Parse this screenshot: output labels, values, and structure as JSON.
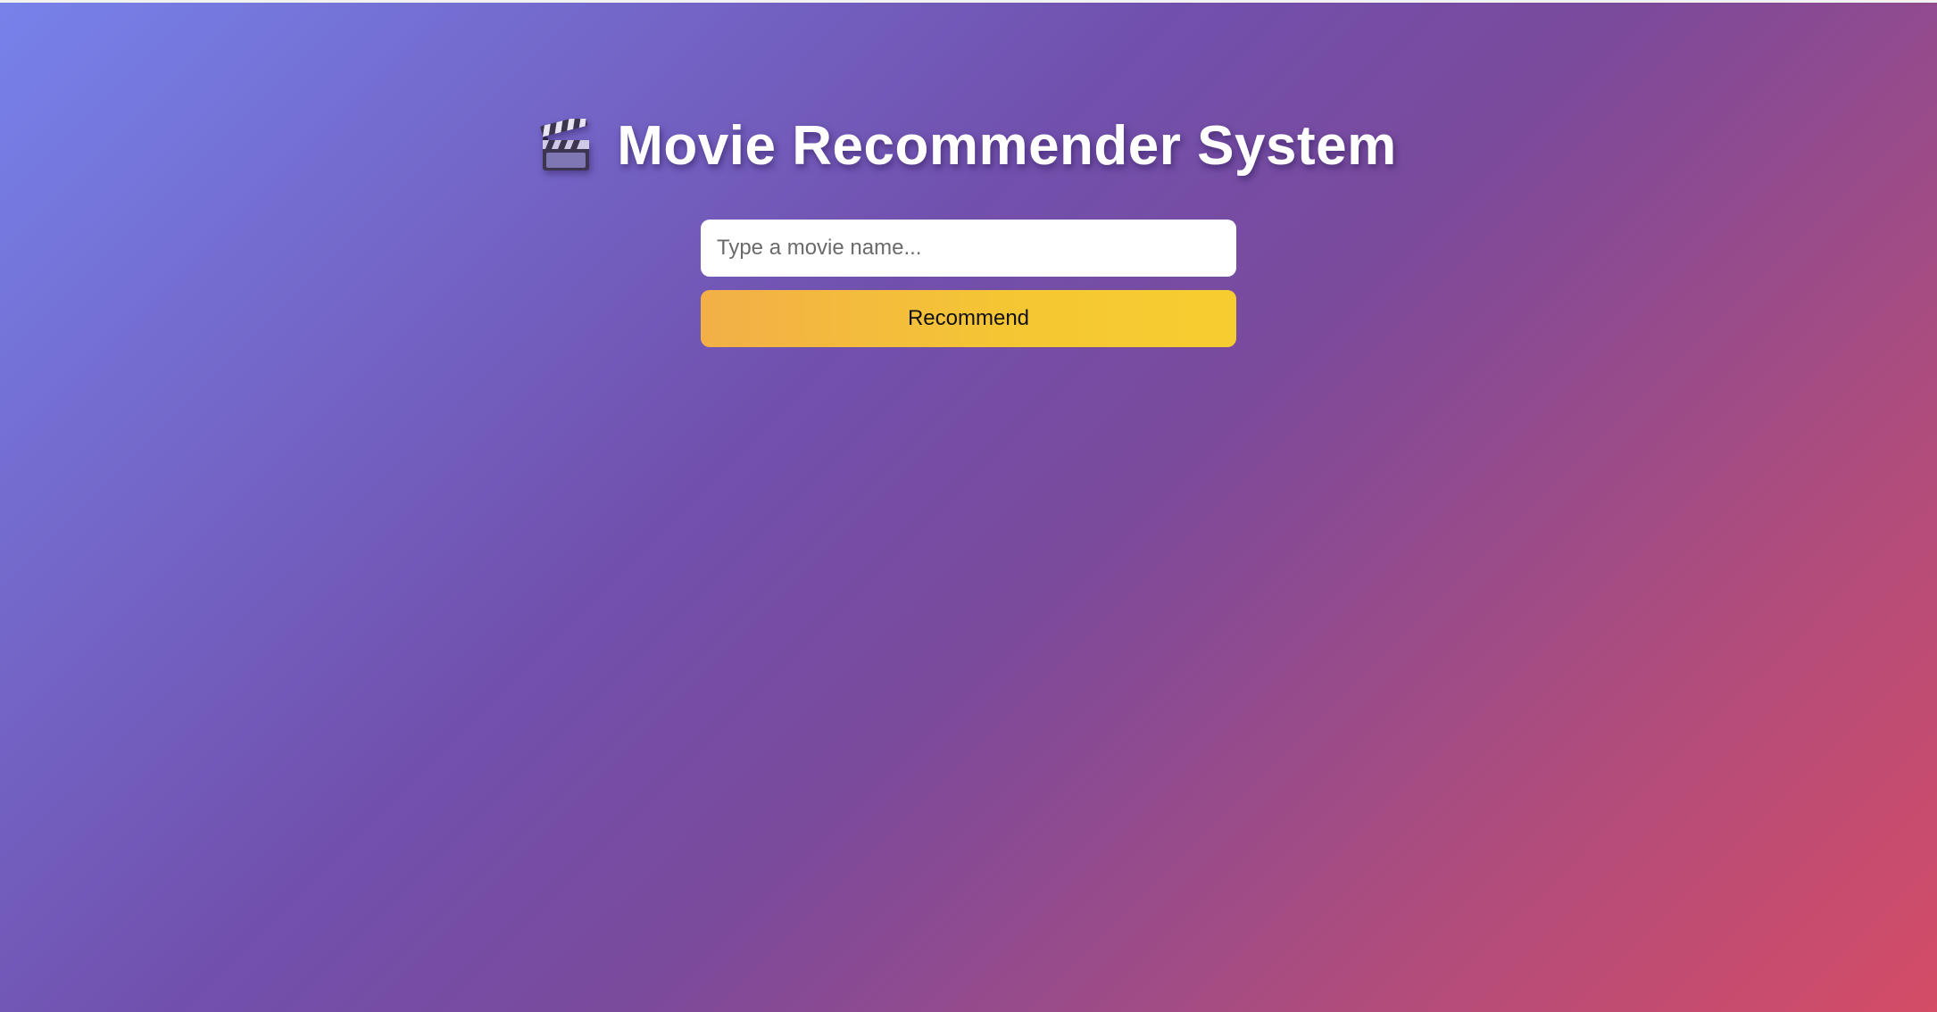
{
  "header": {
    "title": "Movie Recommender System",
    "icon": "clapperboard-icon"
  },
  "search": {
    "placeholder": "Type a movie name...",
    "value": ""
  },
  "actions": {
    "recommend_label": "Recommend"
  },
  "colors": {
    "gradient_start": "#7682ea",
    "gradient_mid": "#7150ad",
    "gradient_end": "#d44c66",
    "button_start": "#f2b047",
    "button_end": "#f6cd30"
  }
}
